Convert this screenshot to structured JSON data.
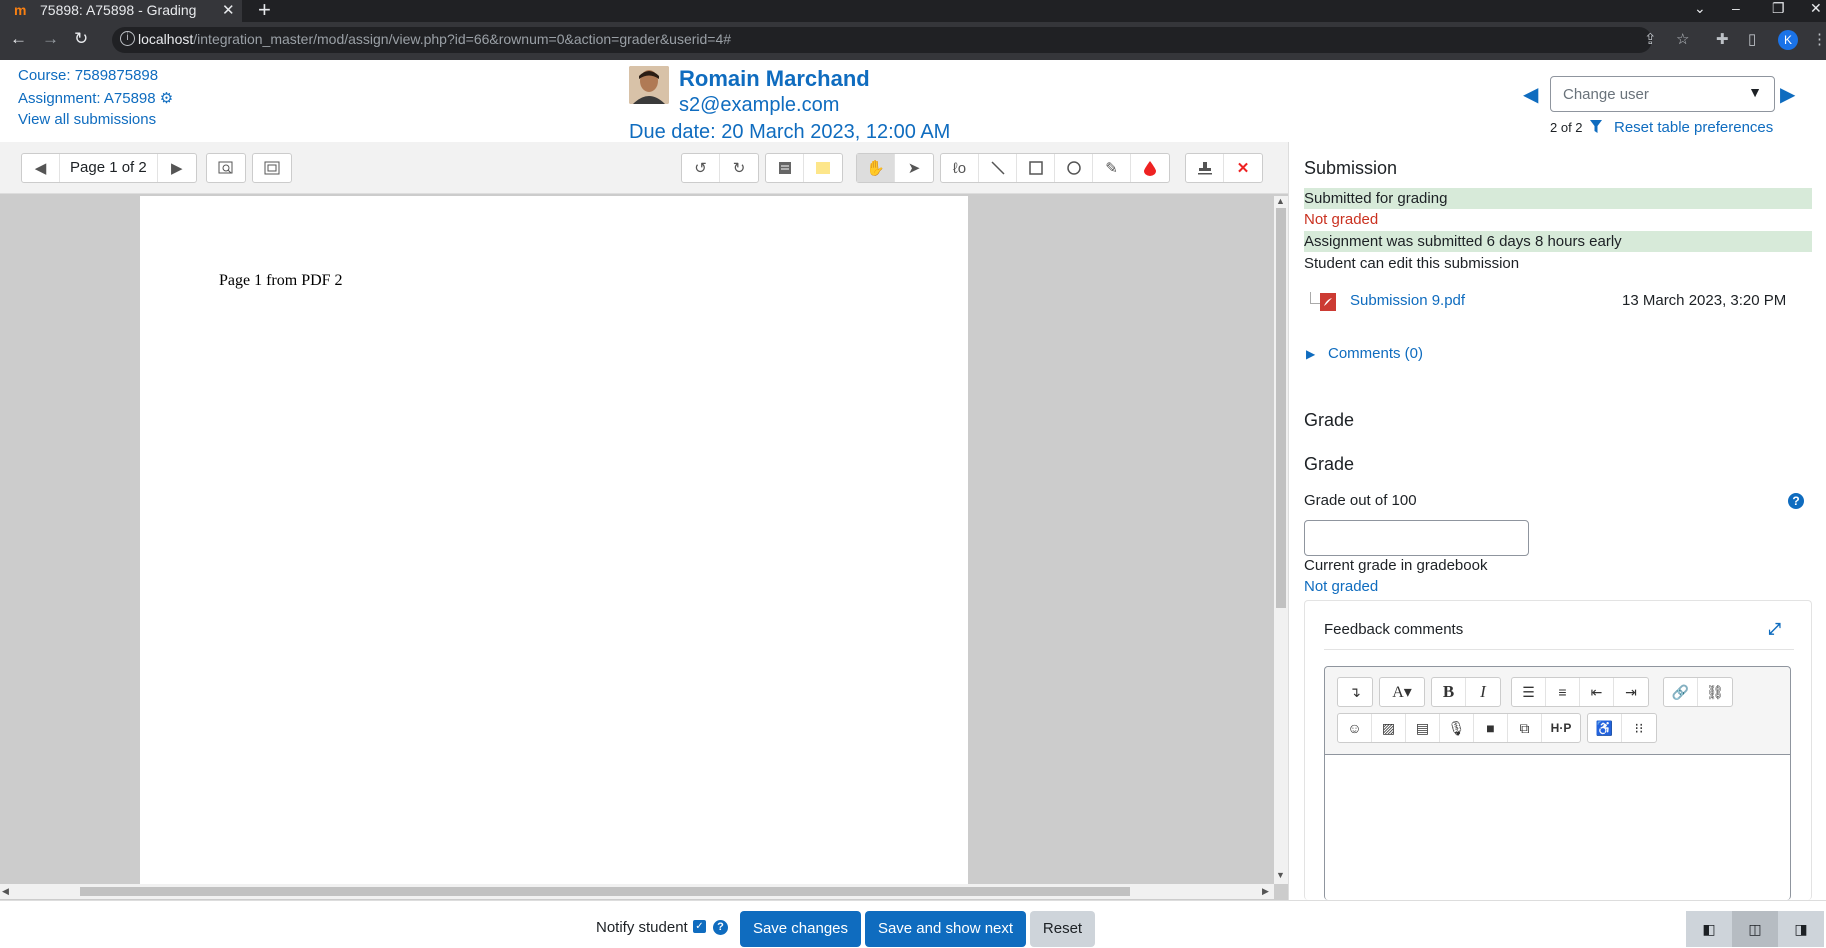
{
  "browser": {
    "tab_title": "75898: A75898 - Grading",
    "tab_favicon": "m",
    "new_tab": "+",
    "url_host": "localhost",
    "url_path": "/integration_master/mod/assign/view.php?id=66&rownum=0&action=grader&userid=4#",
    "profile_initial": "K"
  },
  "header": {
    "course": "Course: 7589875898",
    "assignment": "Assignment: A75898",
    "view_all": "View all submissions",
    "user_name": "Romain Marchand",
    "user_email": "s2@example.com",
    "due_date": "Due date: 20 March 2023, 12:00 AM",
    "change_user_placeholder": "Change user",
    "count": "2 of 2",
    "reset_prefs": "Reset table preferences"
  },
  "pdf": {
    "page_info": "Page 1 of 2",
    "page_text": "Page 1 from PDF 2"
  },
  "submission": {
    "heading": "Submission",
    "status": "Submitted for grading",
    "grading_status": "Not graded",
    "timing": "Assignment was submitted 6 days 8 hours early",
    "edit_status": "Student can edit this submission",
    "file_name": "Submission 9.pdf",
    "file_date": "13 March 2023, 3:20 PM",
    "comments": "Comments (0)"
  },
  "grade": {
    "heading1": "Grade",
    "heading2": "Grade",
    "label": "Grade out of 100",
    "value": "",
    "current_label": "Current grade in gradebook",
    "current_value": "Not graded",
    "feedback_label": "Feedback comments"
  },
  "footer": {
    "notify_label": "Notify student",
    "notify_checked": true,
    "save": "Save changes",
    "save_next": "Save and show next",
    "reset": "Reset"
  },
  "colors": {
    "brand": "#0f6cbf",
    "success_bg": "#d7ead9",
    "danger": "#ca3120"
  }
}
